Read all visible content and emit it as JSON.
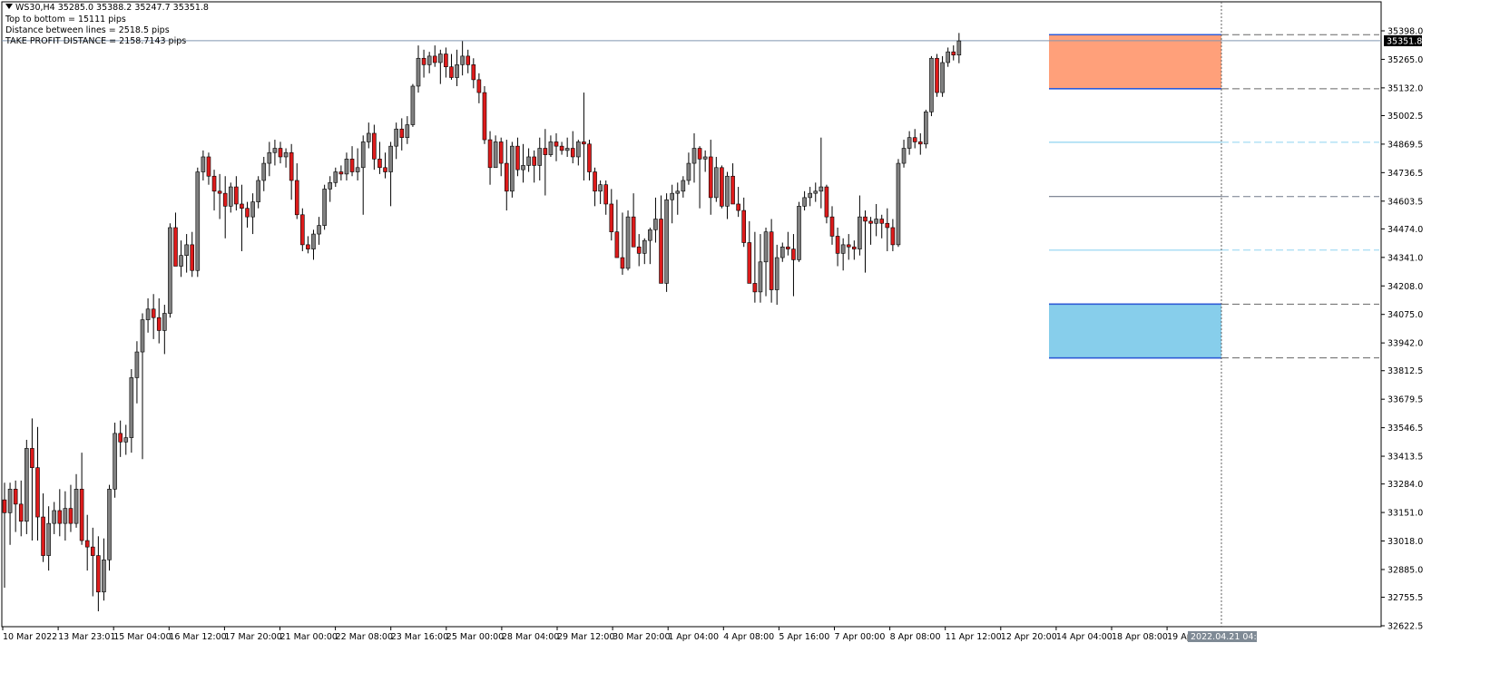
{
  "header": {
    "symbol_line": "WS30,H4  35285.0 35388.2 35247.7 35351.8",
    "info_lines": [
      "Top to bottom = 15111 pips",
      "Distance between lines = 2518.5 pips",
      "TAKE PROFIT DISTANCE = 2158.7143 pips"
    ]
  },
  "current_price_label": "35351.8",
  "crosshair_time_label": "2022.04.21 04:00",
  "colors": {
    "bull_candle": "#808080",
    "bear_candle": "#dd1b1b",
    "upper_zone": "#ffa07a",
    "lower_zone": "#87ceeb",
    "zone_border": "#2f5bd6",
    "level_line": "#8fd3f0",
    "mid_line": "#707888"
  },
  "chart_data": {
    "type": "candlestick",
    "timeframe": "H4",
    "symbol": "WS30",
    "ylim": [
      32622.5,
      35398.0
    ],
    "y_ticks": [
      35398.0,
      35265.0,
      35132.0,
      35002.5,
      34869.5,
      34736.5,
      34603.5,
      34474.0,
      34341.0,
      34208.0,
      34075.0,
      33942.0,
      33812.5,
      33679.5,
      33546.5,
      33413.5,
      33284.0,
      33151.0,
      33018.0,
      32885.0,
      32755.5,
      32622.5
    ],
    "x_ticks": [
      "10 Mar 2022",
      "13 Mar 23:01",
      "15 Mar 04:00",
      "16 Mar 12:00",
      "17 Mar 20:00",
      "21 Mar 00:00",
      "22 Mar 08:00",
      "23 Mar 16:00",
      "25 Mar 00:00",
      "28 Mar 04:00",
      "29 Mar 12:00",
      "30 Mar 20:00",
      "1 Apr 04:00",
      "4 Apr 08:00",
      "5 Apr 16:00",
      "7 Apr 00:00",
      "8 Apr 08:00",
      "11 Apr 12:00",
      "12 Apr 20:00",
      "14 Apr 04:00",
      "18 Apr 08:00",
      "19 Apr"
    ],
    "current_price": 35351.8,
    "zones": [
      {
        "top": 35380.0,
        "bottom": 35128.0,
        "color": "upper_zone"
      },
      {
        "top": 34123.0,
        "bottom": 33872.0,
        "color": "lower_zone"
      }
    ],
    "levels": [
      {
        "price": 34878.0,
        "style": "level"
      },
      {
        "price": 34625.0,
        "style": "mid"
      },
      {
        "price": 34375.0,
        "style": "level"
      }
    ],
    "candles": [
      [
        33210,
        33290,
        32800,
        33150
      ],
      [
        33150,
        33290,
        33000,
        33260
      ],
      [
        33260,
        33300,
        33060,
        33190
      ],
      [
        33190,
        33300,
        33040,
        33110
      ],
      [
        33110,
        33490,
        33050,
        33450
      ],
      [
        33450,
        33590,
        33020,
        33360
      ],
      [
        33360,
        33550,
        33020,
        33130
      ],
      [
        33130,
        33240,
        32920,
        32950
      ],
      [
        32950,
        33180,
        32880,
        33100
      ],
      [
        33100,
        33200,
        33050,
        33160
      ],
      [
        33160,
        33260,
        33040,
        33100
      ],
      [
        33100,
        33250,
        33020,
        33170
      ],
      [
        33170,
        33280,
        33060,
        33100
      ],
      [
        33100,
        33330,
        33080,
        33260
      ],
      [
        33260,
        33430,
        33000,
        33020
      ],
      [
        33020,
        33140,
        32880,
        32990
      ],
      [
        32990,
        33080,
        32760,
        32950
      ],
      [
        32950,
        33040,
        32690,
        32780
      ],
      [
        32780,
        33030,
        32740,
        32930
      ],
      [
        32930,
        33280,
        32880,
        33260
      ],
      [
        33260,
        33570,
        33220,
        33520
      ],
      [
        33520,
        33580,
        33410,
        33480
      ],
      [
        33480,
        33560,
        33420,
        33500
      ],
      [
        33500,
        33820,
        33430,
        33780
      ],
      [
        33780,
        33950,
        33660,
        33900
      ],
      [
        33900,
        34080,
        33400,
        34050
      ],
      [
        34050,
        34150,
        33990,
        34100
      ],
      [
        34100,
        34170,
        33960,
        34060
      ],
      [
        34060,
        34150,
        33940,
        34000
      ],
      [
        34000,
        34120,
        33890,
        34080
      ],
      [
        34080,
        34500,
        34060,
        34480
      ],
      [
        34480,
        34550,
        34380,
        34300
      ],
      [
        34300,
        34420,
        34250,
        34350
      ],
      [
        34350,
        34450,
        34270,
        34400
      ],
      [
        34400,
        34460,
        34250,
        34280
      ],
      [
        34280,
        34760,
        34250,
        34740
      ],
      [
        34740,
        34840,
        34700,
        34810
      ],
      [
        34810,
        34830,
        34680,
        34720
      ],
      [
        34720,
        34750,
        34560,
        34650
      ],
      [
        34650,
        34730,
        34520,
        34640
      ],
      [
        34640,
        34720,
        34430,
        34580
      ],
      [
        34580,
        34690,
        34550,
        34670
      ],
      [
        34670,
        34720,
        34560,
        34590
      ],
      [
        34590,
        34680,
        34370,
        34570
      ],
      [
        34570,
        34600,
        34480,
        34530
      ],
      [
        34530,
        34640,
        34450,
        34600
      ],
      [
        34600,
        34720,
        34570,
        34700
      ],
      [
        34700,
        34810,
        34650,
        34780
      ],
      [
        34780,
        34880,
        34720,
        34830
      ],
      [
        34830,
        34890,
        34770,
        34850
      ],
      [
        34850,
        34880,
        34780,
        34810
      ],
      [
        34810,
        34850,
        34760,
        34830
      ],
      [
        34830,
        34870,
        34610,
        34700
      ],
      [
        34700,
        34780,
        34520,
        34540
      ],
      [
        34540,
        34570,
        34370,
        34400
      ],
      [
        34400,
        34440,
        34360,
        34380
      ],
      [
        34380,
        34470,
        34330,
        34450
      ],
      [
        34450,
        34530,
        34400,
        34490
      ],
      [
        34490,
        34680,
        34470,
        34660
      ],
      [
        34660,
        34720,
        34600,
        34690
      ],
      [
        34690,
        34760,
        34670,
        34740
      ],
      [
        34740,
        34770,
        34700,
        34730
      ],
      [
        34730,
        34830,
        34700,
        34800
      ],
      [
        34800,
        34860,
        34720,
        34740
      ],
      [
        34740,
        34850,
        34700,
        34760
      ],
      [
        34760,
        34910,
        34540,
        34880
      ],
      [
        34880,
        34970,
        34850,
        34920
      ],
      [
        34920,
        34960,
        34750,
        34800
      ],
      [
        34800,
        34880,
        34730,
        34760
      ],
      [
        34760,
        34830,
        34710,
        34740
      ],
      [
        34740,
        34880,
        34580,
        34860
      ],
      [
        34860,
        34970,
        34800,
        34940
      ],
      [
        34940,
        34990,
        34840,
        34900
      ],
      [
        34900,
        35000,
        34870,
        34960
      ],
      [
        34960,
        35150,
        34950,
        35140
      ],
      [
        35140,
        35330,
        35110,
        35270
      ],
      [
        35270,
        35310,
        35180,
        35240
      ],
      [
        35240,
        35300,
        35200,
        35280
      ],
      [
        35280,
        35330,
        35230,
        35250
      ],
      [
        35250,
        35310,
        35150,
        35290
      ],
      [
        35290,
        35320,
        35180,
        35230
      ],
      [
        35230,
        35290,
        35170,
        35180
      ],
      [
        35180,
        35310,
        35140,
        35240
      ],
      [
        35240,
        35350,
        35190,
        35280
      ],
      [
        35280,
        35310,
        35200,
        35240
      ],
      [
        35240,
        35270,
        35130,
        35170
      ],
      [
        35170,
        35200,
        35060,
        35110
      ],
      [
        35110,
        35140,
        34870,
        34890
      ],
      [
        34890,
        34930,
        34680,
        34760
      ],
      [
        34760,
        34910,
        34760,
        34880
      ],
      [
        34880,
        34900,
        34720,
        34780
      ],
      [
        34780,
        34890,
        34560,
        34650
      ],
      [
        34650,
        34880,
        34620,
        34860
      ],
      [
        34860,
        34900,
        34720,
        34750
      ],
      [
        34750,
        34870,
        34690,
        34770
      ],
      [
        34770,
        34850,
        34740,
        34810
      ],
      [
        34810,
        34840,
        34690,
        34770
      ],
      [
        34770,
        34900,
        34700,
        34850
      ],
      [
        34850,
        34940,
        34630,
        34820
      ],
      [
        34820,
        34910,
        34810,
        34880
      ],
      [
        34880,
        34920,
        34790,
        34860
      ],
      [
        34860,
        34880,
        34820,
        34840
      ],
      [
        34840,
        34900,
        34810,
        34850
      ],
      [
        34850,
        34930,
        34780,
        34810
      ],
      [
        34810,
        34890,
        34770,
        34880
      ],
      [
        34880,
        35110,
        34700,
        34870
      ],
      [
        34870,
        34890,
        34700,
        34740
      ],
      [
        34740,
        34760,
        34580,
        34650
      ],
      [
        34650,
        34700,
        34590,
        34680
      ],
      [
        34680,
        34700,
        34540,
        34590
      ],
      [
        34590,
        34660,
        34420,
        34460
      ],
      [
        34460,
        34610,
        34350,
        34340
      ],
      [
        34340,
        34550,
        34260,
        34290
      ],
      [
        34290,
        34560,
        34280,
        34530
      ],
      [
        34530,
        34640,
        34410,
        34390
      ],
      [
        34390,
        34450,
        34300,
        34360
      ],
      [
        34360,
        34430,
        34310,
        34420
      ],
      [
        34420,
        34480,
        34310,
        34470
      ],
      [
        34470,
        34620,
        34410,
        34520
      ],
      [
        34520,
        34630,
        34350,
        34220
      ],
      [
        34220,
        34640,
        34180,
        34610
      ],
      [
        34610,
        34680,
        34500,
        34640
      ],
      [
        34640,
        34690,
        34540,
        34650
      ],
      [
        34650,
        34720,
        34620,
        34700
      ],
      [
        34700,
        34830,
        34680,
        34780
      ],
      [
        34780,
        34920,
        34690,
        34850
      ],
      [
        34850,
        34860,
        34570,
        34800
      ],
      [
        34800,
        34840,
        34740,
        34810
      ],
      [
        34810,
        34890,
        34540,
        34620
      ],
      [
        34620,
        34810,
        34600,
        34760
      ],
      [
        34760,
        34770,
        34570,
        34580
      ],
      [
        34580,
        34740,
        34520,
        34720
      ],
      [
        34720,
        34780,
        34610,
        34590
      ],
      [
        34590,
        34670,
        34530,
        34560
      ],
      [
        34560,
        34620,
        34390,
        34410
      ],
      [
        34410,
        34510,
        34270,
        34220
      ],
      [
        34220,
        34460,
        34130,
        34180
      ],
      [
        34180,
        34450,
        34130,
        34320
      ],
      [
        34320,
        34480,
        34160,
        34460
      ],
      [
        34460,
        34520,
        34130,
        34190
      ],
      [
        34190,
        34400,
        34120,
        34340
      ],
      [
        34340,
        34410,
        34320,
        34390
      ],
      [
        34390,
        34460,
        34350,
        34380
      ],
      [
        34380,
        34450,
        34160,
        34330
      ],
      [
        34330,
        34600,
        34320,
        34580
      ],
      [
        34580,
        34650,
        34560,
        34620
      ],
      [
        34620,
        34670,
        34580,
        34640
      ],
      [
        34640,
        34690,
        34600,
        34650
      ],
      [
        34650,
        34900,
        34570,
        34670
      ],
      [
        34670,
        34680,
        34500,
        34530
      ],
      [
        34530,
        34580,
        34400,
        34440
      ],
      [
        34440,
        34480,
        34300,
        34360
      ],
      [
        34360,
        34430,
        34280,
        34400
      ],
      [
        34400,
        34450,
        34330,
        34390
      ],
      [
        34390,
        34420,
        34330,
        34380
      ],
      [
        34380,
        34630,
        34350,
        34530
      ],
      [
        34530,
        34560,
        34270,
        34510
      ],
      [
        34510,
        34530,
        34400,
        34500
      ],
      [
        34500,
        34590,
        34440,
        34520
      ],
      [
        34520,
        34540,
        34430,
        34500
      ],
      [
        34500,
        34570,
        34370,
        34480
      ],
      [
        34480,
        34520,
        34370,
        34400
      ],
      [
        34400,
        34800,
        34390,
        34780
      ],
      [
        34780,
        34890,
        34760,
        34850
      ],
      [
        34850,
        34930,
        34820,
        34900
      ],
      [
        34900,
        34940,
        34850,
        34880
      ],
      [
        34880,
        34920,
        34820,
        34870
      ],
      [
        34870,
        35030,
        34850,
        35020
      ],
      [
        35020,
        35280,
        35000,
        35270
      ],
      [
        35270,
        35290,
        35090,
        35110
      ],
      [
        35110,
        35280,
        35090,
        35250
      ],
      [
        35250,
        35320,
        35230,
        35300
      ],
      [
        35300,
        35330,
        35260,
        35285
      ],
      [
        35285,
        35388,
        35247,
        35351
      ]
    ]
  }
}
